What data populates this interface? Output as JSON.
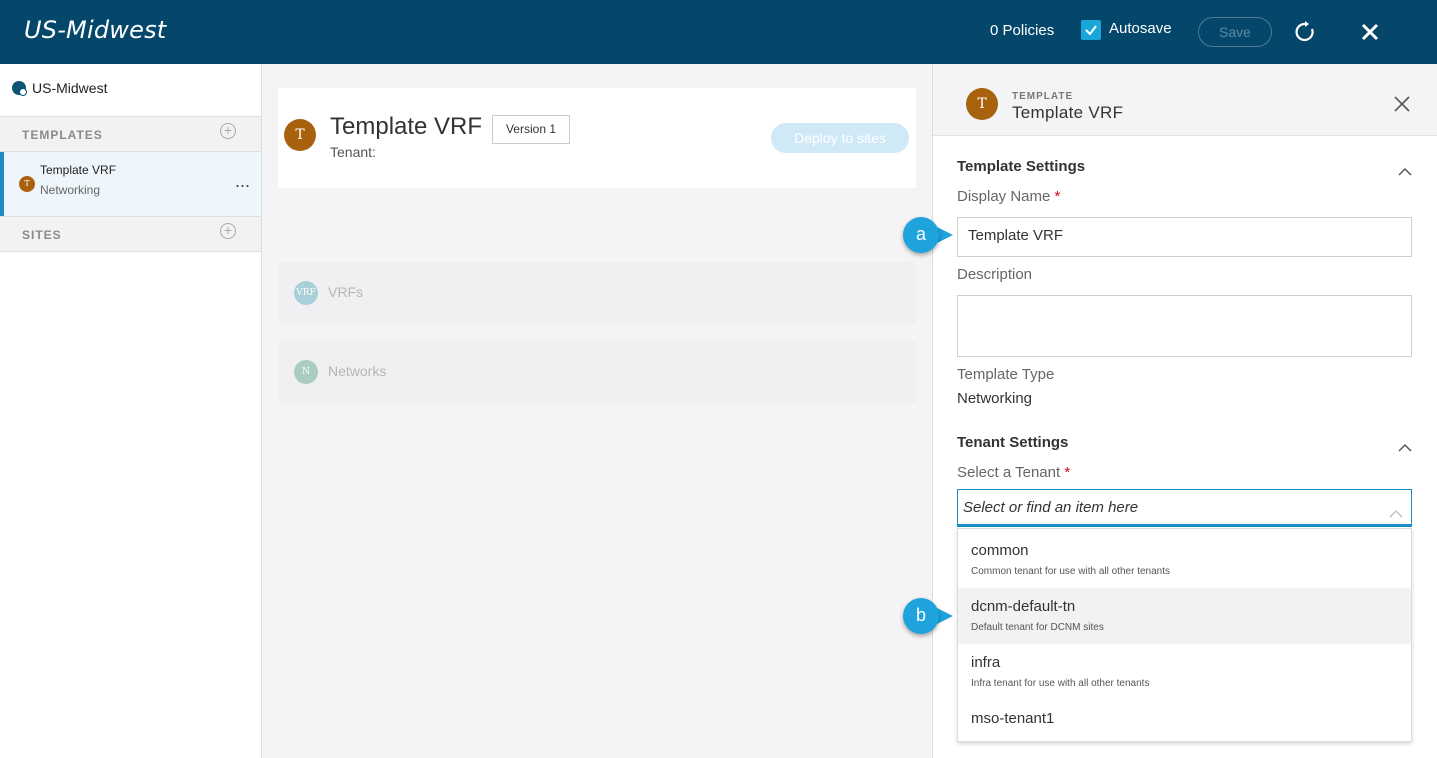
{
  "header": {
    "title": "US-Midwest",
    "policies": "0 Policies",
    "autosave_label": "Autosave",
    "autosave_checked": true,
    "save_label": "Save"
  },
  "sidebar": {
    "site_name": "US-Midwest",
    "templates_header": "TEMPLATES",
    "sites_header": "SITES",
    "template_item": {
      "avatar": "T",
      "title": "Template VRF",
      "subtitle": "Networking",
      "more": "..."
    }
  },
  "main": {
    "avatar": "T",
    "template_name": "Template VRF",
    "version": "Version 1",
    "tenant_label": "Tenant:",
    "deploy_label": "Deploy to sites",
    "sections": [
      {
        "icon": "VRF",
        "label": "VRFs"
      },
      {
        "icon": "N",
        "label": "Networks"
      }
    ]
  },
  "panel": {
    "avatar": "T",
    "kicker": "TEMPLATE",
    "title": "Template VRF",
    "template_settings": "Template Settings",
    "display_name_label": "Display Name",
    "required_mark": "*",
    "display_name_value": "Template VRF",
    "description_label": "Description",
    "description_value": "",
    "template_type_label": "Template Type",
    "template_type_value": "Networking",
    "tenant_settings": "Tenant Settings",
    "select_tenant_label": "Select a Tenant",
    "select_tenant_placeholder": "Select or find an item here",
    "tenant_options": [
      {
        "name": "common",
        "desc": "Common tenant for use with all other tenants"
      },
      {
        "name": "dcnm-default-tn",
        "desc": "Default tenant for DCNM sites"
      },
      {
        "name": "infra",
        "desc": "Infra tenant for use with all other tenants"
      },
      {
        "name": "mso-tenant1",
        "desc": ""
      }
    ]
  },
  "callouts": {
    "a": "a",
    "b": "b"
  },
  "colors": {
    "header_bg": "#04476b",
    "accent": "#1fa3dc",
    "avatar": "#a8620e",
    "highlight_row": "#f2f2f2"
  }
}
